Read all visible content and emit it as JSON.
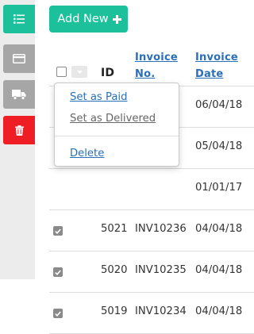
{
  "toolbar": {
    "add_new_label": "Add New"
  },
  "sidebar": {
    "buttons": [
      {
        "icon": "list-icon",
        "color": "#1cc09a"
      },
      {
        "icon": "credit-card-icon",
        "color": "#a6a6a6"
      },
      {
        "icon": "truck-icon",
        "color": "#a6a6a6"
      },
      {
        "icon": "trash-icon",
        "color": "#ef1e24"
      }
    ]
  },
  "table": {
    "headers": {
      "id": "ID",
      "invoice_line1": "Invoice",
      "invoice_line2": "No.",
      "date_line1": "Invoice",
      "date_line2": "Date"
    },
    "rows": [
      {
        "id": "",
        "invoice": "",
        "date": "06/04/18",
        "checked": false
      },
      {
        "id": "",
        "invoice": "",
        "date": "05/04/18",
        "checked": false
      },
      {
        "id": "",
        "invoice": "",
        "date": "01/01/17",
        "checked": false
      },
      {
        "id": "5021",
        "invoice": "INV10236",
        "date": "04/04/18",
        "checked": true
      },
      {
        "id": "5020",
        "invoice": "INV10235",
        "date": "04/04/18",
        "checked": true
      },
      {
        "id": "5019",
        "invoice": "INV10234",
        "date": "04/04/18",
        "checked": true
      }
    ]
  },
  "dropdown": {
    "set_as_paid": "Set as Paid",
    "set_as_delivered": "Set as Delivered",
    "delete": "Delete"
  },
  "colors": {
    "accent": "#1cc09a",
    "danger": "#ef1e24",
    "link": "#2a6fb8"
  }
}
